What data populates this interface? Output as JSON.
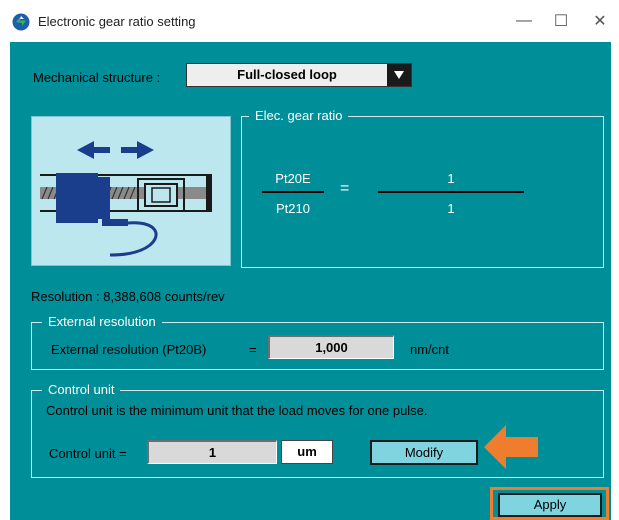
{
  "window": {
    "title": "Electronic gear ratio setting",
    "minimize_glyph": "—",
    "maximize_glyph": "☐",
    "close_glyph": "✕"
  },
  "mechanical": {
    "label": "Mechanical structure :",
    "selected": "Full-closed loop"
  },
  "gear_ratio": {
    "legend": "Elec. gear ratio",
    "numerator_param": "Pt20E",
    "denominator_param": "Pt210",
    "equals": "=",
    "numerator_value": "1",
    "denominator_value": "1"
  },
  "resolution": {
    "text": "Resolution : 8,388,608 counts/rev"
  },
  "external_resolution": {
    "legend": "External resolution",
    "label": "External resolution (Pt20B)",
    "equals": "=",
    "value": "1,000",
    "unit": "nm/cnt"
  },
  "control_unit": {
    "legend": "Control unit",
    "description": "Control unit is the minimum unit that the load moves for one pulse.",
    "label": "Control unit =",
    "value": "1",
    "unit": "um",
    "modify_label": "Modify"
  },
  "footer": {
    "apply_label": "Apply"
  },
  "colors": {
    "background": "#008f99",
    "highlight": "#ee7d2f",
    "button": "#7fd4e0"
  },
  "icons": [
    "app-logo-icon",
    "dropdown-arrow-icon",
    "arrow-left-right-icon",
    "ball-screw-icon",
    "arrow-pointer-icon"
  ]
}
